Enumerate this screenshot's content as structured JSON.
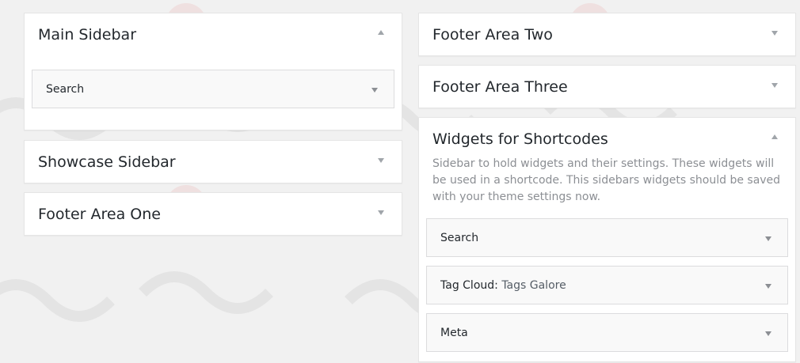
{
  "left_column": {
    "main_sidebar": {
      "title": "Main Sidebar",
      "widgets": [
        {
          "title": "Search"
        }
      ]
    },
    "showcase_sidebar": {
      "title": "Showcase Sidebar"
    },
    "footer_area_one": {
      "title": "Footer Area One"
    }
  },
  "right_column": {
    "footer_area_two": {
      "title": "Footer Area Two"
    },
    "footer_area_three": {
      "title": "Footer Area Three"
    },
    "widgets_for_shortcodes": {
      "title": "Widgets for Shortcodes",
      "description": "Sidebar to hold widgets and their settings. These widgets will be used in a shortcode. This sidebars widgets should be saved with your theme settings now.",
      "widgets": [
        {
          "title": "Search"
        },
        {
          "title": "Tag Cloud",
          "in_title": "Tags Galore"
        },
        {
          "title": "Meta"
        }
      ]
    }
  },
  "colors": {
    "background": "#f1f1f1",
    "panel": "#ffffff",
    "widget_bg": "#f9f9f9",
    "text": "#23282d",
    "muted": "#8c8f94",
    "watermark": "#e02424"
  },
  "icons": {
    "expanded_toggle": "triangle-up-icon",
    "collapsed_toggle": "triangle-down-icon",
    "widget_toggle": "triangle-down-icon"
  }
}
